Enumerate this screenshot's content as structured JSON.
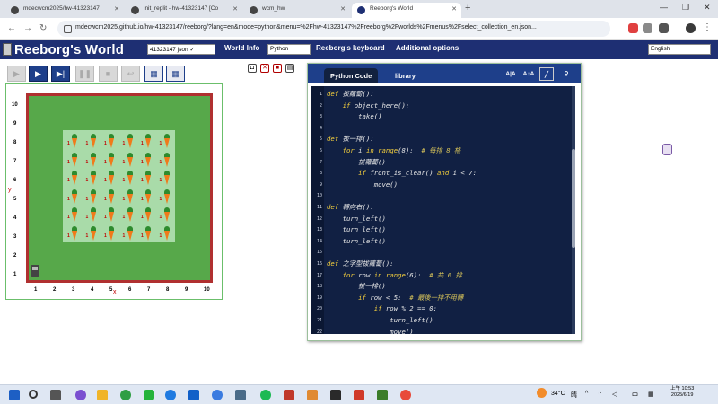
{
  "browser": {
    "tabs": [
      {
        "title": "mdecwcm2025/hw-41323147"
      },
      {
        "title": "init_replit - hw-41323147 [Co"
      },
      {
        "title": "wcm_hw"
      },
      {
        "title": "Reeborg's World"
      }
    ],
    "url": "mdecwcm2025.github.io/hw-41323147/reeborg/?lang=en&mode=python&menu=%2Fhw-41323147%2Freeborg%2Fworlds%2Fmenus%2Fselect_collection_en.json..."
  },
  "header": {
    "app_title": "Reeborg's World",
    "world_select": "41323147 json ✓",
    "world_info": "World Info",
    "language_select": "Python",
    "keyboard": "Reeborg's keyboard",
    "options": "Additional options",
    "ui_language": "English"
  },
  "world": {
    "x_labels": [
      "1",
      "2",
      "3",
      "4",
      "5",
      "6",
      "7",
      "8",
      "9",
      "10"
    ],
    "y_labels": [
      "10",
      "9",
      "8",
      "7",
      "6",
      "5",
      "4",
      "3",
      "2",
      "1"
    ],
    "x_axis_letter": "x",
    "y_axis_letter": "y",
    "carrot_rows": 6,
    "carrot_cols": 6,
    "carrot_count_label": "1"
  },
  "editor": {
    "tab_code": "Python Code",
    "tab_library": "library",
    "tools": [
      "A|A",
      "A↑A"
    ],
    "lines": [
      {
        "n": "1",
        "tokens": [
          [
            "kw",
            "def "
          ],
          [
            "nm",
            "拔蘿蔔():"
          ]
        ]
      },
      {
        "n": "2",
        "tokens": [
          [
            "nm",
            "    "
          ],
          [
            "kw",
            "if "
          ],
          [
            "nm",
            "object_here():"
          ]
        ]
      },
      {
        "n": "3",
        "tokens": [
          [
            "nm",
            "        take()"
          ]
        ]
      },
      {
        "n": "4",
        "tokens": []
      },
      {
        "n": "5",
        "tokens": [
          [
            "kw",
            "def "
          ],
          [
            "nm",
            "拔一排():"
          ]
        ]
      },
      {
        "n": "6",
        "tokens": [
          [
            "nm",
            "    "
          ],
          [
            "kw",
            "for "
          ],
          [
            "nm",
            "i "
          ],
          [
            "kw",
            "in "
          ],
          [
            "kw",
            "range"
          ],
          [
            "nm",
            "(8):  "
          ],
          [
            "cm",
            "# 每排 8 格"
          ]
        ]
      },
      {
        "n": "7",
        "tokens": [
          [
            "nm",
            "        拔蘿蔔()"
          ]
        ]
      },
      {
        "n": "8",
        "tokens": [
          [
            "nm",
            "        "
          ],
          [
            "kw",
            "if "
          ],
          [
            "nm",
            "front_is_clear() "
          ],
          [
            "kw",
            "and "
          ],
          [
            "nm",
            "i < 7:"
          ]
        ]
      },
      {
        "n": "9",
        "tokens": [
          [
            "nm",
            "            move()"
          ]
        ]
      },
      {
        "n": "10",
        "tokens": []
      },
      {
        "n": "11",
        "tokens": [
          [
            "kw",
            "def "
          ],
          [
            "nm",
            "轉向右():"
          ]
        ]
      },
      {
        "n": "12",
        "tokens": [
          [
            "nm",
            "    turn_left()"
          ]
        ]
      },
      {
        "n": "13",
        "tokens": [
          [
            "nm",
            "    turn_left()"
          ]
        ]
      },
      {
        "n": "14",
        "tokens": [
          [
            "nm",
            "    turn_left()"
          ]
        ]
      },
      {
        "n": "15",
        "tokens": []
      },
      {
        "n": "16",
        "tokens": [
          [
            "kw",
            "def "
          ],
          [
            "nm",
            "之字型拔蘿蔔():"
          ]
        ]
      },
      {
        "n": "17",
        "tokens": [
          [
            "nm",
            "    "
          ],
          [
            "kw",
            "for "
          ],
          [
            "nm",
            "row "
          ],
          [
            "kw",
            "in "
          ],
          [
            "kw",
            "range"
          ],
          [
            "nm",
            "(6):  "
          ],
          [
            "cm",
            "# 共 6 排"
          ]
        ]
      },
      {
        "n": "18",
        "tokens": [
          [
            "nm",
            "        拔一排()"
          ]
        ]
      },
      {
        "n": "19",
        "tokens": [
          [
            "nm",
            "        "
          ],
          [
            "kw",
            "if "
          ],
          [
            "nm",
            "row < 5:  "
          ],
          [
            "cm",
            "# 最後一排不用轉"
          ]
        ]
      },
      {
        "n": "20",
        "tokens": [
          [
            "nm",
            "            "
          ],
          [
            "kw",
            "if "
          ],
          [
            "nm",
            "row % 2 == 0:"
          ]
        ]
      },
      {
        "n": "21",
        "tokens": [
          [
            "nm",
            "                turn_left()"
          ]
        ]
      },
      {
        "n": "22",
        "tokens": [
          [
            "nm",
            "                move()"
          ]
        ]
      }
    ]
  },
  "taskbar": {
    "temperature": "34°C",
    "weather": "晴",
    "ime": "中",
    "time_line1": "上午 10:53",
    "time_line2": "2025/6/19"
  }
}
